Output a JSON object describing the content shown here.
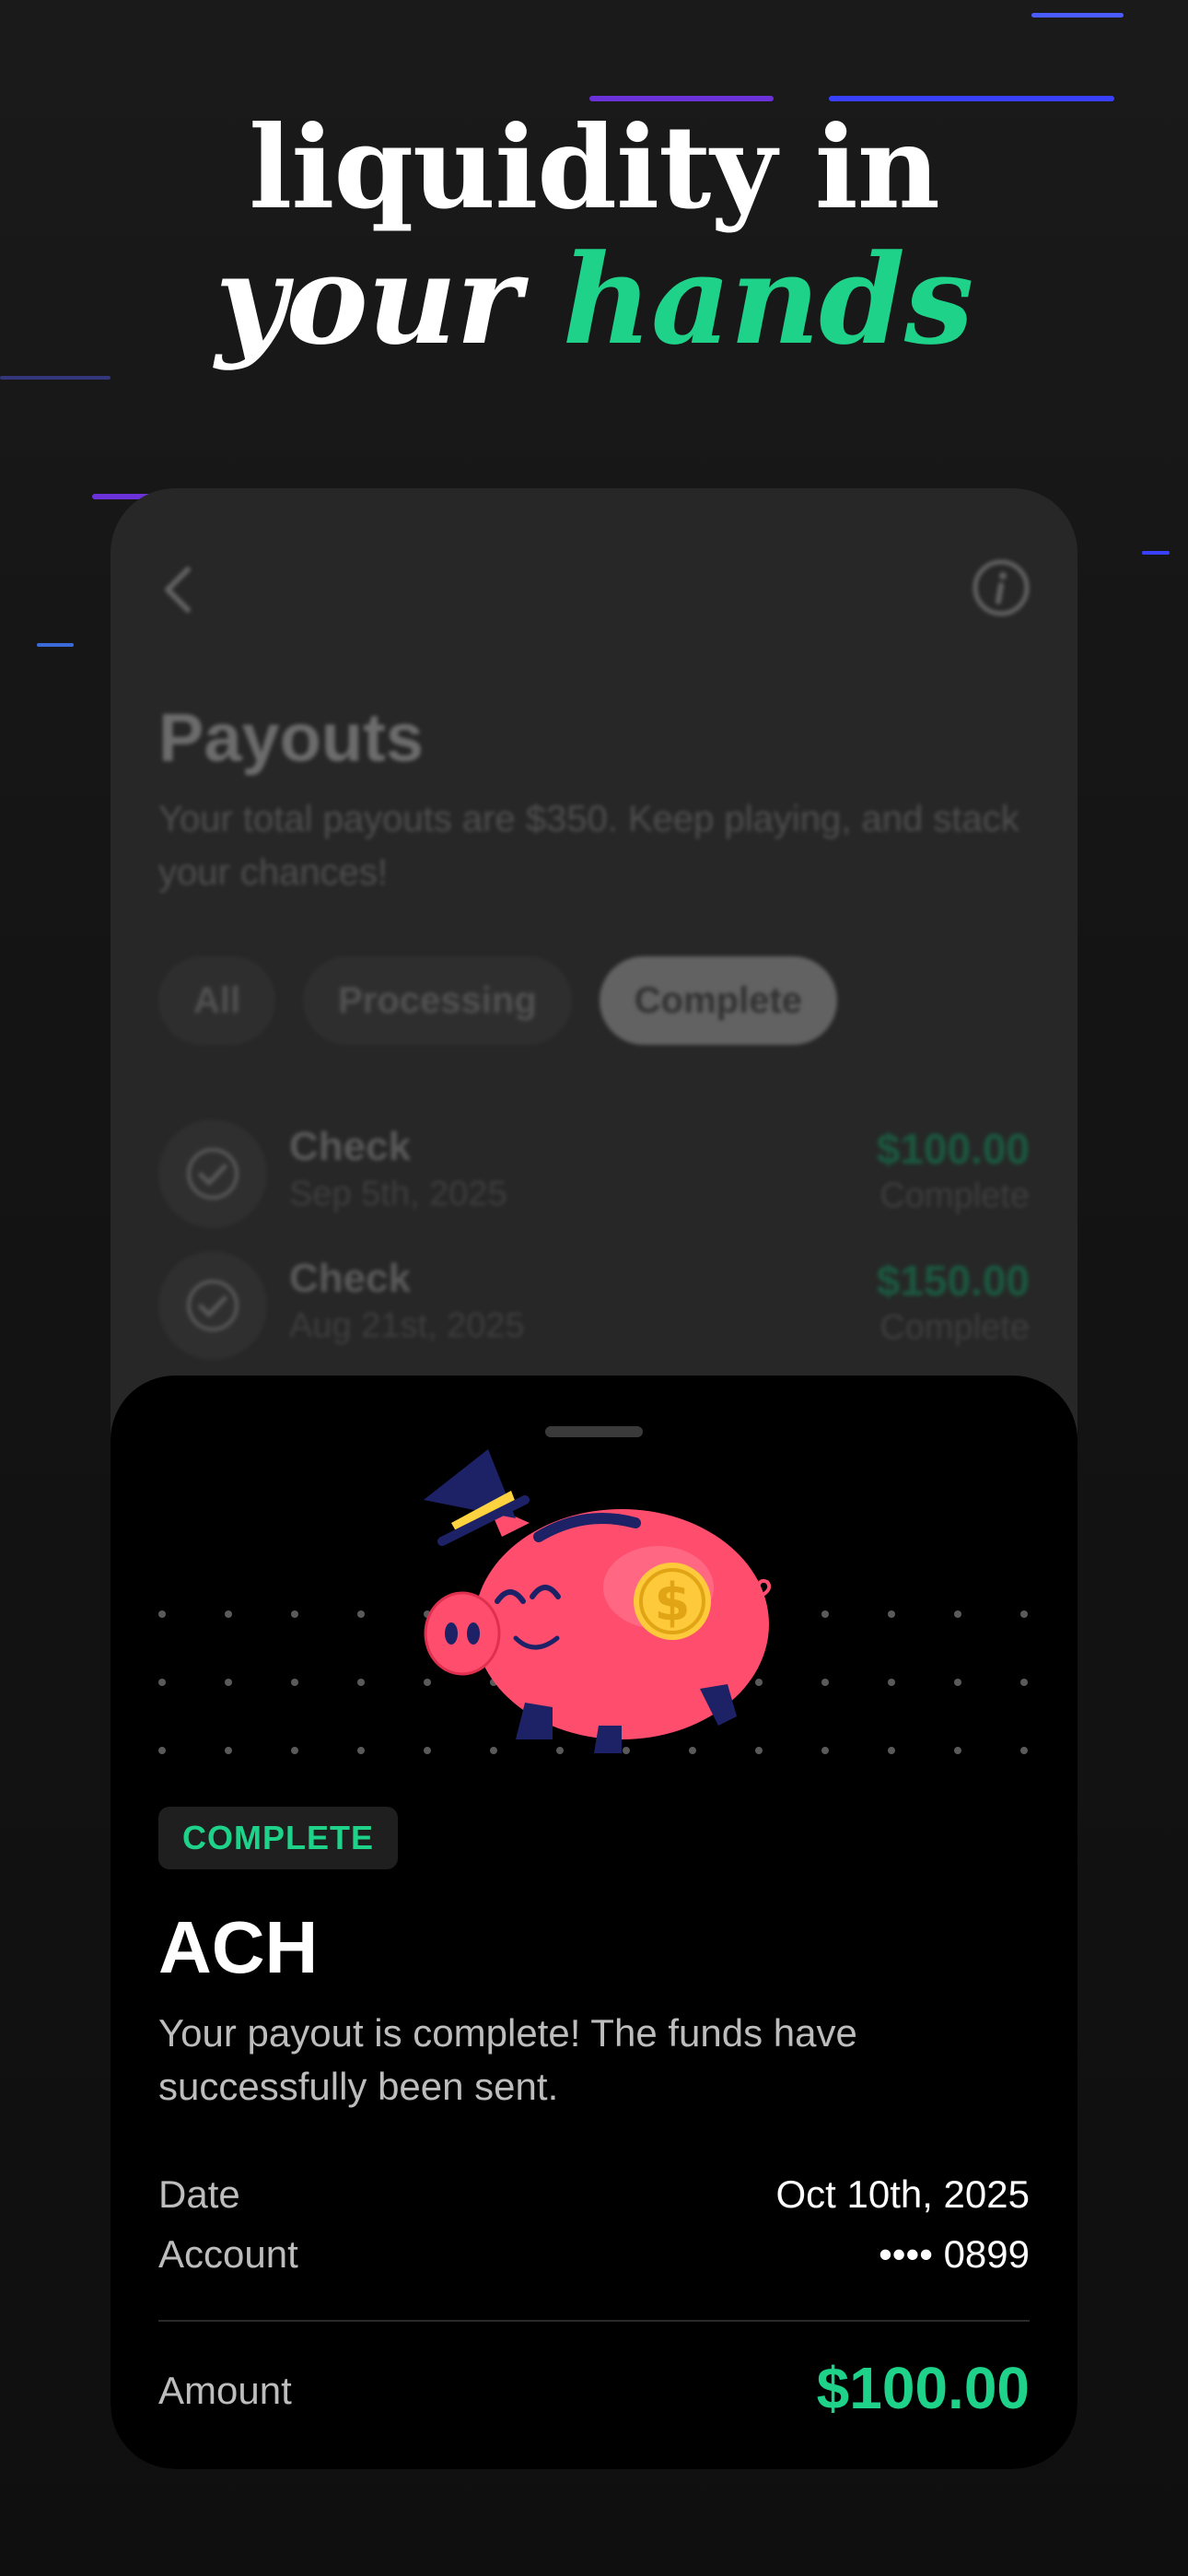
{
  "headline": {
    "line1": "liquidity in",
    "line2_plain": "your ",
    "line2_accent": "hands"
  },
  "colors": {
    "accent": "#1ed28a",
    "pig": "#ff4d6d",
    "hat": "#1d2266"
  },
  "background_screen": {
    "title": "Payouts",
    "description": "Your total payouts are $350. Keep playing, and stack your chances!",
    "filters": [
      {
        "label": "All",
        "active": false
      },
      {
        "label": "Processing",
        "active": false
      },
      {
        "label": "Complete",
        "active": true
      }
    ],
    "payouts": [
      {
        "name": "Check",
        "date": "Sep 5th, 2025",
        "amount": "$100.00",
        "status": "Complete"
      },
      {
        "name": "Check",
        "date": "Aug 21st, 2025",
        "amount": "$150.00",
        "status": "Complete"
      }
    ]
  },
  "sheet": {
    "status_badge": "COMPLETE",
    "title": "ACH",
    "message": "Your payout is complete! The funds have successfully been sent.",
    "details": [
      {
        "label": "Date",
        "value": "Oct 10th, 2025"
      },
      {
        "label": "Account",
        "value": "•••• 0899"
      }
    ],
    "amount_label": "Amount",
    "amount_value": "$100.00"
  }
}
